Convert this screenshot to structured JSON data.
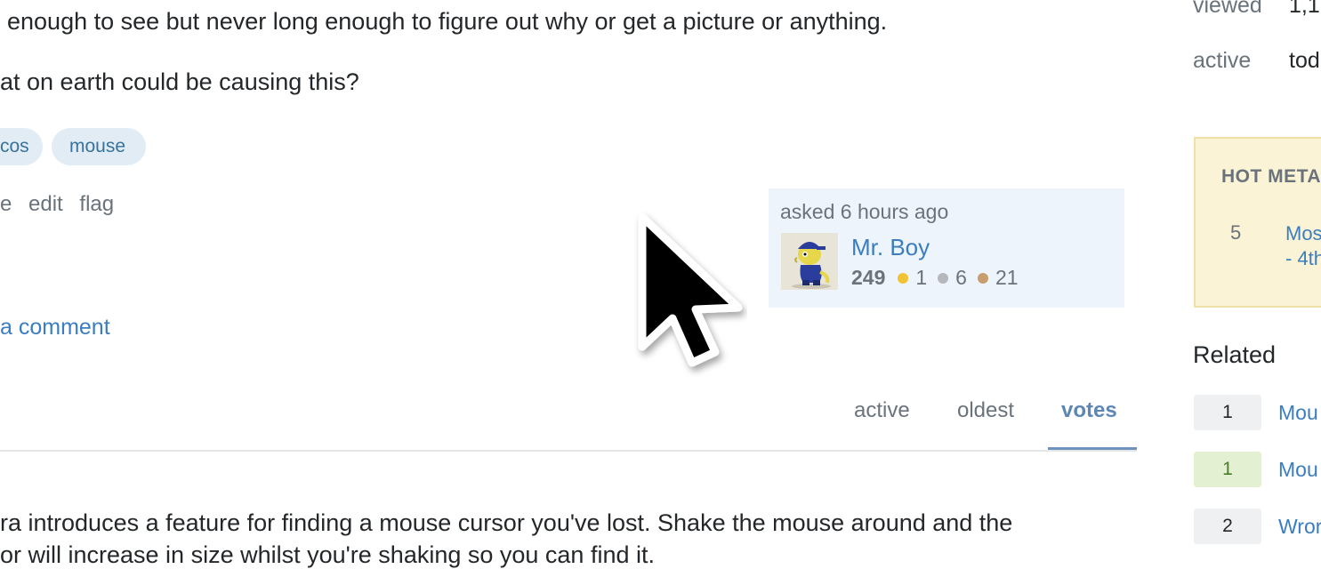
{
  "question": {
    "body_line_partial": "enough to see but never long enough to figure out why or get a picture or anything.",
    "body_question": "at on earth could be causing this?",
    "tags": [
      "cos",
      "mouse"
    ],
    "post_menu": [
      "e",
      "edit",
      "flag"
    ],
    "add_comment": "a comment",
    "owner": {
      "asked": "asked 6 hours ago",
      "name": "Mr. Boy",
      "reputation": "249",
      "gold": "1",
      "silver": "6",
      "bronze": "21"
    }
  },
  "answers_sort": {
    "tabs": [
      "active",
      "oldest",
      "votes"
    ],
    "selected": "votes"
  },
  "answer": {
    "line1": "ra introduces a feature for finding a mouse cursor you've lost. Shake the mouse around and the",
    "line2": "or will increase in size whilst you're shaking so you can find it."
  },
  "sidebar": {
    "stats": [
      {
        "label": "viewed",
        "value": "1,1"
      },
      {
        "label": "active",
        "value": "tod"
      }
    ],
    "hot_meta": {
      "title": "HOT META",
      "items": [
        {
          "count": "5",
          "line1": "Mos",
          "line2": "- 4th"
        }
      ]
    },
    "related": {
      "title": "Related",
      "items": [
        {
          "votes": "1",
          "answered": false,
          "text": "Mou"
        },
        {
          "votes": "1",
          "answered": true,
          "text": "Mou"
        },
        {
          "votes": "2",
          "answered": false,
          "text": "Wror"
        }
      ]
    }
  },
  "colors": {
    "link": "#3a7dc0",
    "tag_bg": "#e1ecf4",
    "owner_card_bg": "#eef4fb",
    "gold": "#f1c233",
    "silver": "#b4b8bc",
    "bronze": "#c99e6e",
    "hot_meta_bg": "#fbf3d5"
  }
}
